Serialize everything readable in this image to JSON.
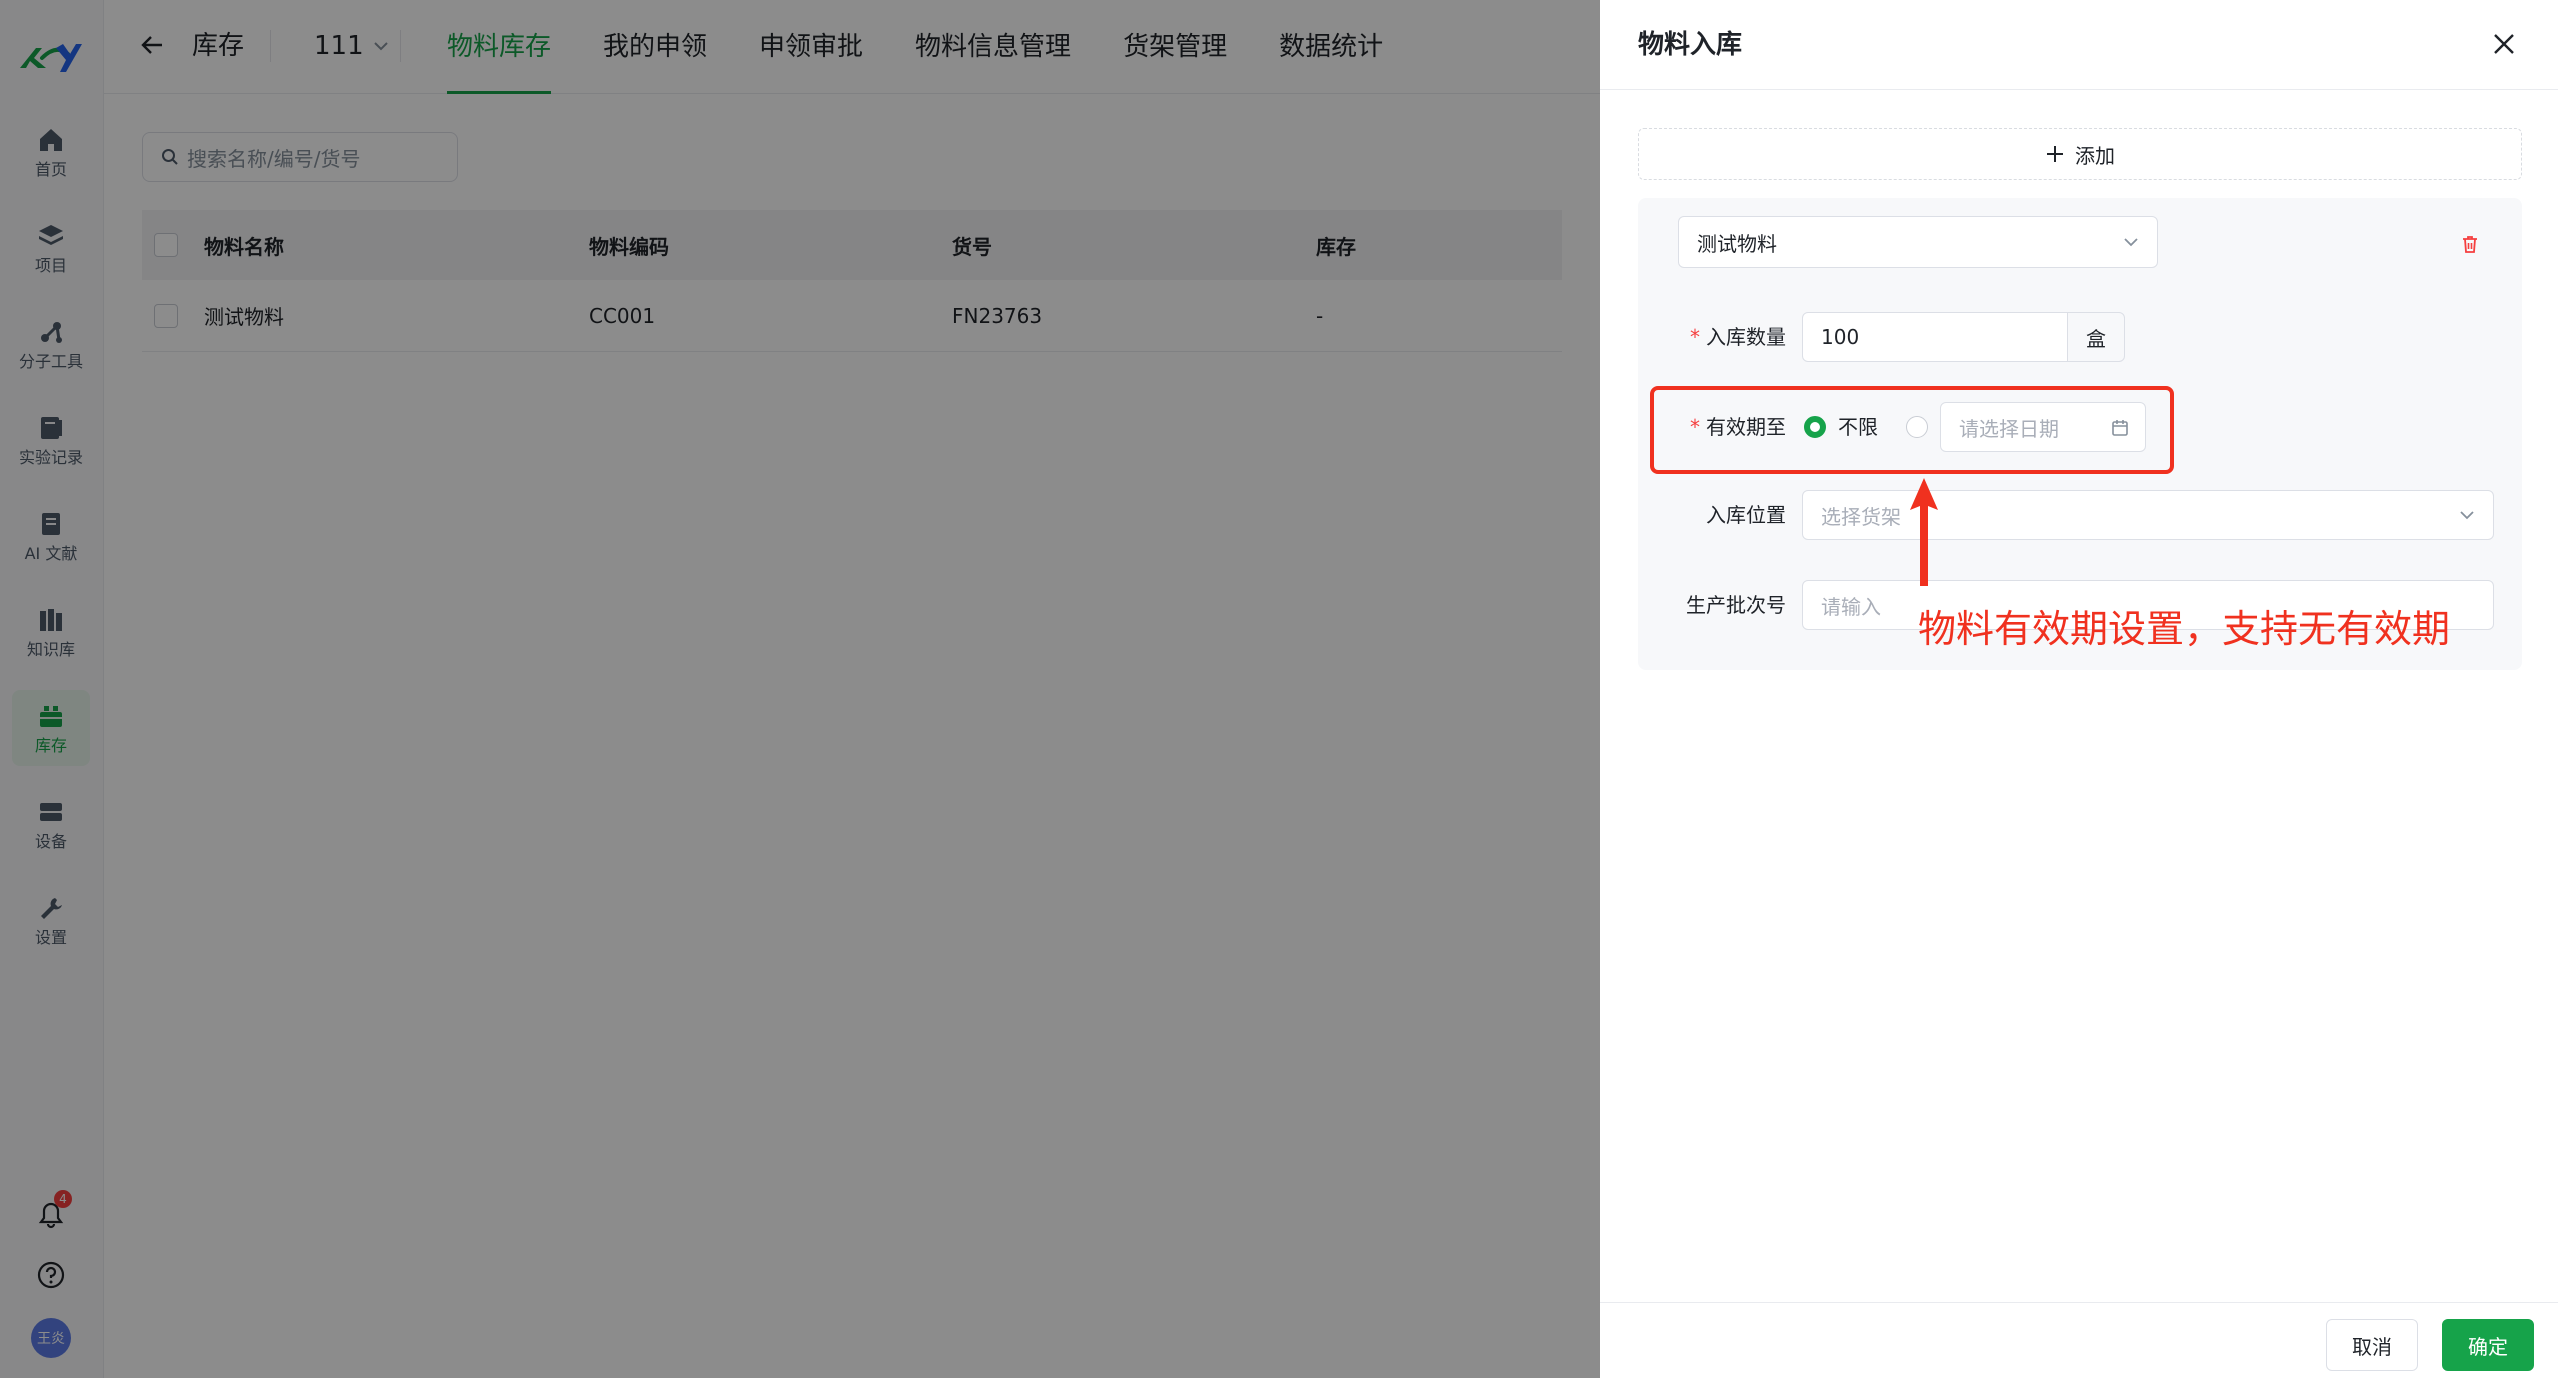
{
  "sidebar": {
    "items": [
      {
        "label": "首页",
        "icon": "home-icon"
      },
      {
        "label": "项目",
        "icon": "layers-icon"
      },
      {
        "label": "分子工具",
        "icon": "molecule-icon"
      },
      {
        "label": "实验记录",
        "icon": "notebook-icon"
      },
      {
        "label": "AI 文献",
        "icon": "book-icon"
      },
      {
        "label": "知识库",
        "icon": "library-icon"
      },
      {
        "label": "库存",
        "icon": "inventory-icon"
      },
      {
        "label": "设备",
        "icon": "device-icon"
      },
      {
        "label": "设置",
        "icon": "settings-icon"
      }
    ],
    "active_index": 6,
    "notification_count": "4",
    "avatar_text": "王炎"
  },
  "header": {
    "module_title": "库存",
    "project": "111",
    "tabs": [
      "物料库存",
      "我的申领",
      "申领审批",
      "物料信息管理",
      "货架管理",
      "数据统计"
    ],
    "active_tab": 0
  },
  "main": {
    "search_placeholder": "搜索名称/编号/货号",
    "table": {
      "columns": [
        "物料名称",
        "物料编码",
        "货号",
        "库存"
      ],
      "rows": [
        [
          "测试物料",
          "CC001",
          "FN23763",
          "-"
        ]
      ]
    }
  },
  "drawer": {
    "title": "物料入库",
    "add_label": "添加",
    "material_select": "测试物料",
    "fields": {
      "quantity_label": "入库数量",
      "quantity_value": "100",
      "quantity_unit": "盒",
      "expiry_label": "有效期至",
      "expiry_unlimited": "不限",
      "expiry_date_placeholder": "请选择日期",
      "location_label": "入库位置",
      "location_placeholder": "选择货架",
      "batch_label": "生产批次号",
      "batch_placeholder": "请输入"
    },
    "cancel_label": "取消",
    "confirm_label": "确定"
  },
  "annotation": {
    "text": "物料有效期设置，支持无有效期",
    "color": "#f0311f"
  },
  "colors": {
    "accent": "#16a34a",
    "danger": "#f53f3f"
  }
}
